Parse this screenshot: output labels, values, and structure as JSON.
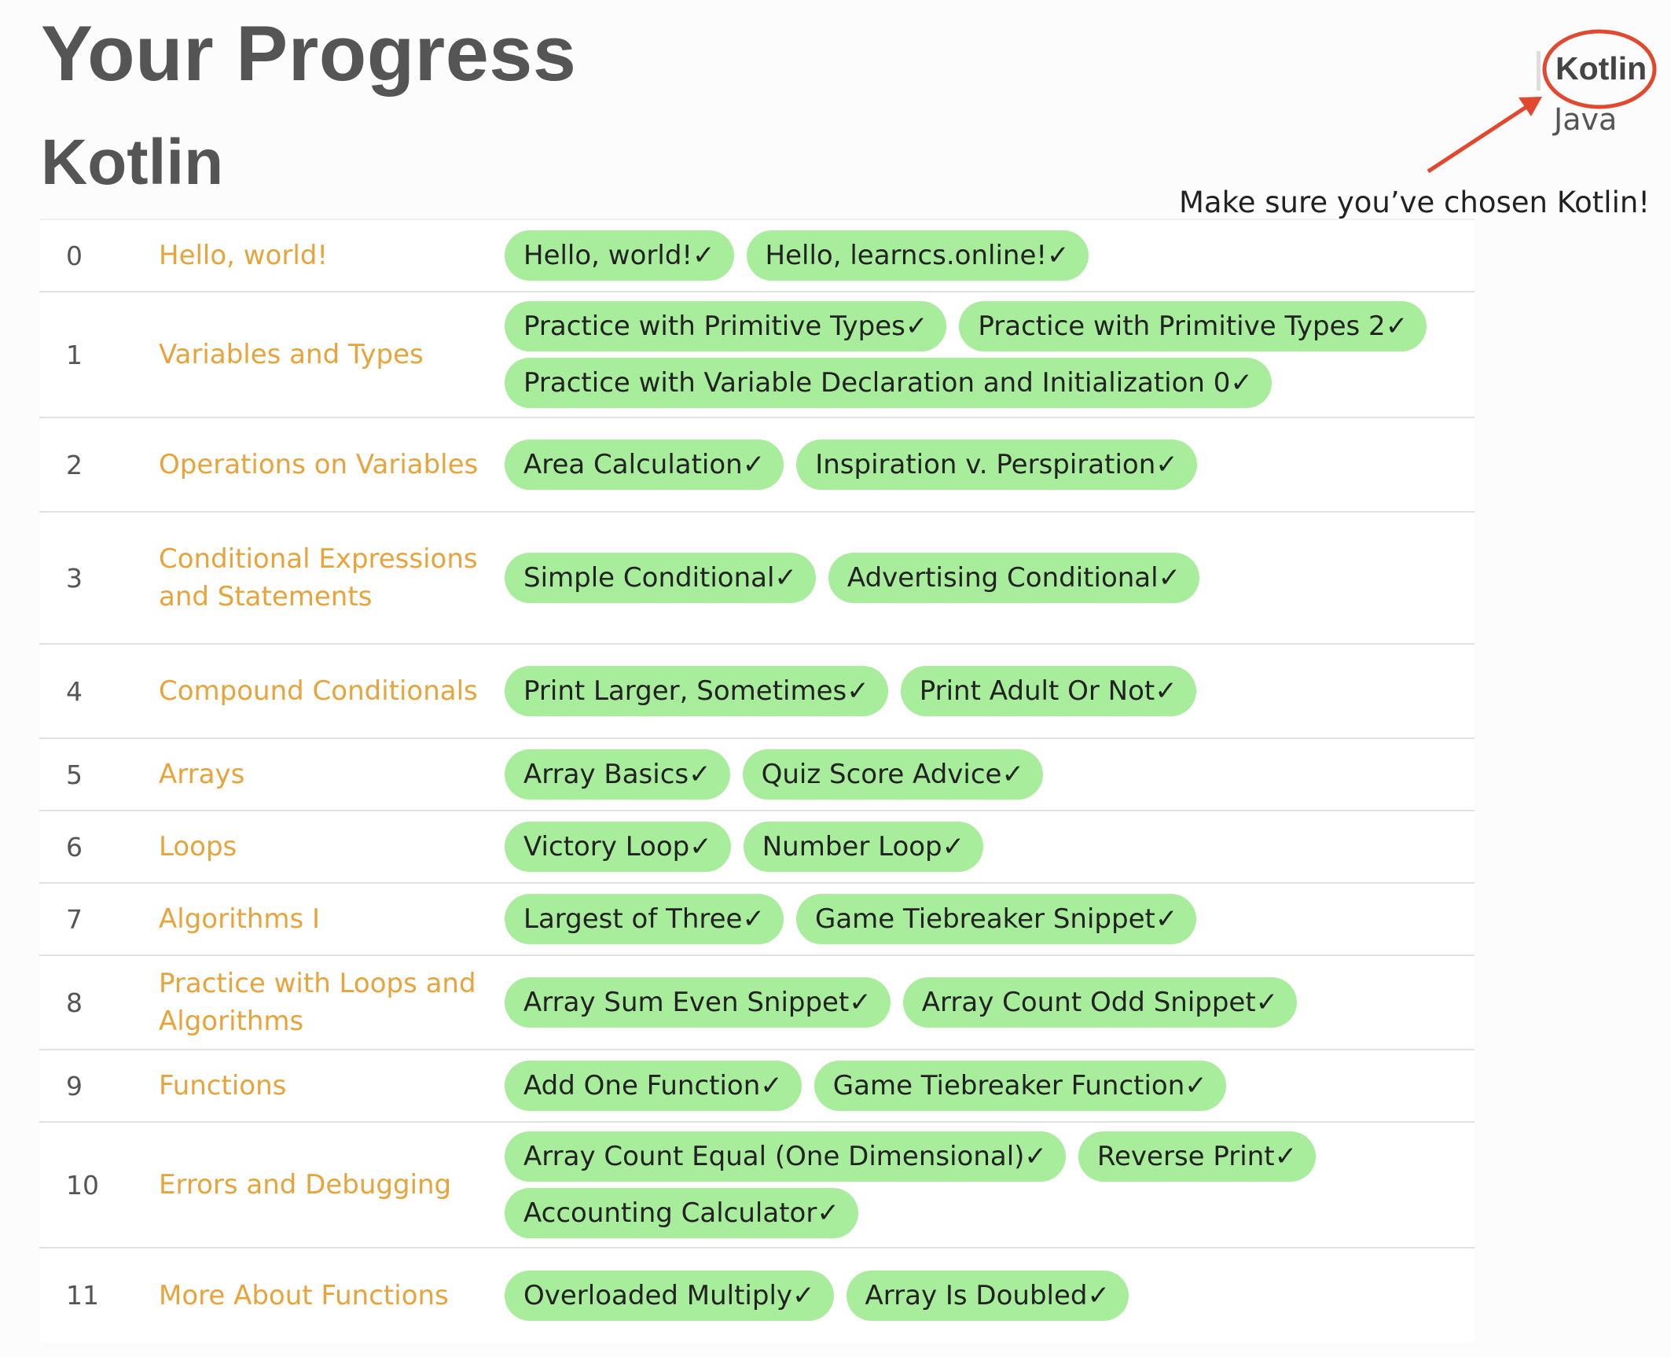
{
  "header": {
    "title": "Your Progress",
    "section": "Kotlin"
  },
  "language_switch": {
    "selected": "Kotlin",
    "other": "Java"
  },
  "annotation": {
    "text": "Make sure you’ve chosen Kotlin!",
    "color": "#e2482e"
  },
  "colors": {
    "topic_link": "#e8a33a",
    "pill_background": "#a8ed9c"
  },
  "lessons": [
    {
      "num": "0",
      "topic": "Hello, world!",
      "problems": [
        "Hello, world!✓",
        "Hello, learncs.online!✓"
      ]
    },
    {
      "num": "1",
      "topic": "Variables and Types",
      "problems": [
        "Practice with Primitive Types✓",
        "Practice with Primitive Types 2✓",
        "Practice with Variable Declaration and Initialization 0✓"
      ]
    },
    {
      "num": "2",
      "topic": "Operations on Variables",
      "problems": [
        "Area Calculation✓",
        "Inspiration v. Perspiration✓"
      ]
    },
    {
      "num": "3",
      "topic": "Conditional Expressions and Statements",
      "problems": [
        "Simple Conditional✓",
        "Advertising Conditional✓"
      ]
    },
    {
      "num": "4",
      "topic": "Compound Conditionals",
      "problems": [
        "Print Larger, Sometimes✓",
        "Print Adult Or Not✓"
      ]
    },
    {
      "num": "5",
      "topic": "Arrays",
      "problems": [
        "Array Basics✓",
        "Quiz Score Advice✓"
      ]
    },
    {
      "num": "6",
      "topic": "Loops",
      "problems": [
        "Victory Loop✓",
        "Number Loop✓"
      ]
    },
    {
      "num": "7",
      "topic": "Algorithms I",
      "problems": [
        "Largest of Three✓",
        "Game Tiebreaker Snippet✓"
      ]
    },
    {
      "num": "8",
      "topic": "Practice with Loops and Algorithms",
      "problems": [
        "Array Sum Even Snippet✓",
        "Array Count Odd Snippet✓"
      ]
    },
    {
      "num": "9",
      "topic": "Functions",
      "problems": [
        "Add One Function✓",
        "Game Tiebreaker Function✓"
      ]
    },
    {
      "num": "10",
      "topic": "Errors and Debugging",
      "problems": [
        "Array Count Equal (One Dimensional)✓",
        "Reverse Print✓",
        "Accounting Calculator✓"
      ]
    },
    {
      "num": "11",
      "topic": "More About Functions",
      "problems": [
        "Overloaded Multiply✓",
        "Array Is Doubled✓"
      ]
    }
  ]
}
